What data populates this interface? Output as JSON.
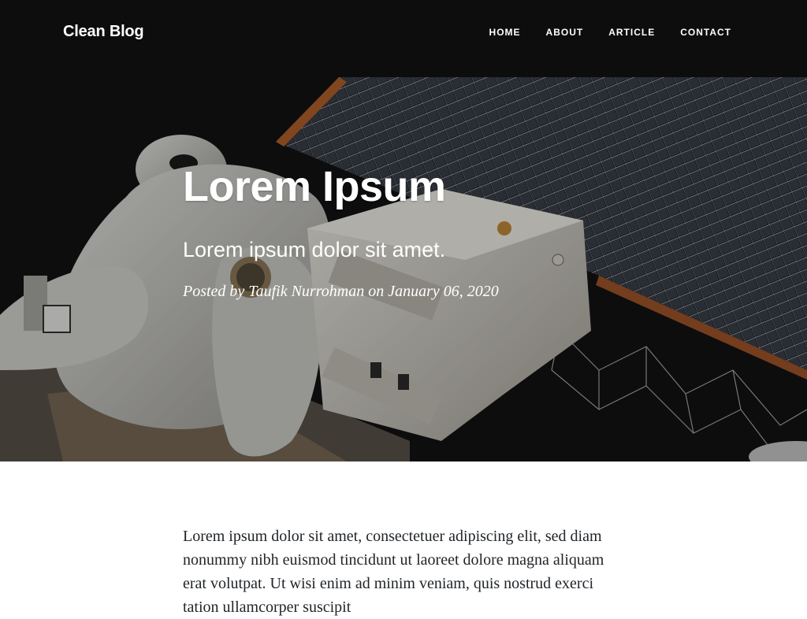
{
  "nav": {
    "brand": "Clean Blog",
    "links": [
      {
        "label": "HOME"
      },
      {
        "label": "ABOUT"
      },
      {
        "label": "ARTICLE"
      },
      {
        "label": "CONTACT"
      }
    ]
  },
  "hero": {
    "title": "Lorem Ipsum",
    "subtitle": "Lorem ipsum dolor sit amet.",
    "meta": "Posted by Taufik Nurrohman on January 06, 2020"
  },
  "article": {
    "paragraph": "Lorem ipsum dolor sit amet, consectetuer adipiscing elit, sed diam nonummy nibh euismod tincidunt ut laoreet dolore magna aliquam erat volutpat. Ut wisi enim ad minim veniam, quis nostrud exerci tation ullamcorper suscipit"
  },
  "colors": {
    "hero_background": "#121214",
    "text": "#212529",
    "nav_text": "#ffffff"
  }
}
